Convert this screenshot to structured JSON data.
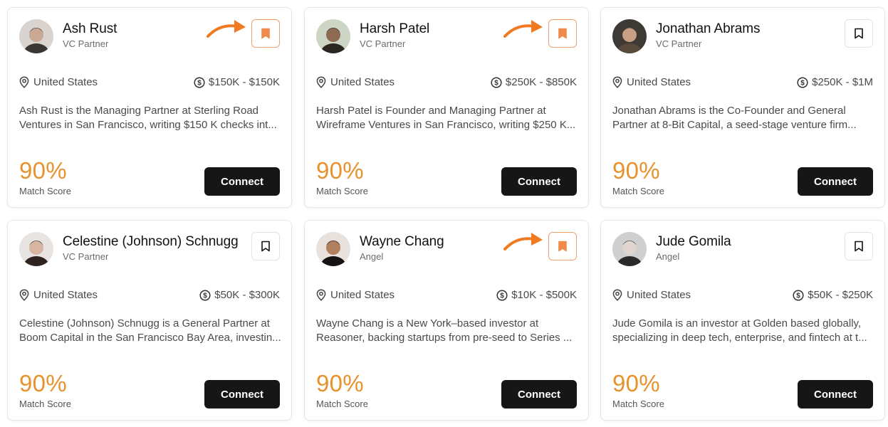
{
  "cards": [
    {
      "name": "Ash Rust",
      "role": "VC Partner",
      "location": "United States",
      "check_size": "$150K - $150K",
      "description_line1": "Ash Rust is the Managing Partner at Sterling Road",
      "description_line2": "Ventures in San Francisco, writing $150 K checks int...",
      "score": "90%",
      "score_label": "Match Score",
      "connect_label": "Connect",
      "bookmarked": true
    },
    {
      "name": "Harsh Patel",
      "role": "VC Partner",
      "location": "United States",
      "check_size": "$250K - $850K",
      "description_line1": "Harsh Patel is Founder and Managing Partner at",
      "description_line2": "Wireframe Ventures in San Francisco, writing $250 K...",
      "score": "90%",
      "score_label": "Match Score",
      "connect_label": "Connect",
      "bookmarked": true
    },
    {
      "name": "Jonathan Abrams",
      "role": "VC Partner",
      "location": "United States",
      "check_size": "$250K - $1M",
      "description_line1": "Jonathan Abrams is the Co-Founder and General",
      "description_line2": "Partner at 8-Bit Capital, a seed-stage venture firm...",
      "score": "90%",
      "score_label": "Match Score",
      "connect_label": "Connect",
      "bookmarked": false
    },
    {
      "name": "Celestine (Johnson) Schnugg",
      "role": "VC Partner",
      "location": "United States",
      "check_size": "$50K - $300K",
      "description_line1": "Celestine (Johnson) Schnugg is a General Partner at",
      "description_line2": "Boom Capital in the San Francisco Bay Area, investin...",
      "score": "90%",
      "score_label": "Match Score",
      "connect_label": "Connect",
      "bookmarked": false
    },
    {
      "name": "Wayne Chang",
      "role": "Angel",
      "location": "United States",
      "check_size": "$10K - $500K",
      "description_line1": "Wayne Chang is a New York–based investor at",
      "description_line2": "Reasoner, backing startups from pre-seed to Series ...",
      "score": "90%",
      "score_label": "Match Score",
      "connect_label": "Connect",
      "bookmarked": true
    },
    {
      "name": "Jude Gomila",
      "role": "Angel",
      "location": "United States",
      "check_size": "$50K - $250K",
      "description_line1": "Jude Gomila is an investor at Golden based globally,",
      "description_line2": "specializing in deep tech, enterprise, and fintech at t...",
      "score": "90%",
      "score_label": "Match Score",
      "connect_label": "Connect",
      "bookmarked": false
    }
  ],
  "colors": {
    "accent": "#e8922d",
    "bookmark_saved": "#f08a4b",
    "arrow": "#f07a22",
    "button": "#161616"
  },
  "icons": {
    "location": "map-pin-icon",
    "check_size": "dollar-circle-icon",
    "bookmark": "bookmark-icon",
    "annotation": "curved-arrow-icon"
  }
}
